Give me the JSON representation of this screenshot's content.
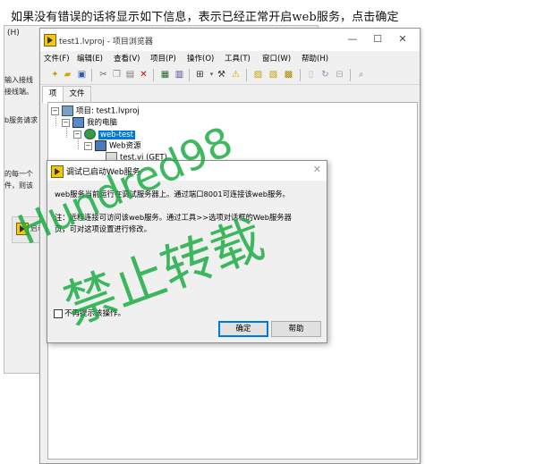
{
  "caption": "如果没有错误的话将显示如下信息，表示已经正常开启web服务，点击确定",
  "background_window": {
    "title_fragment": "(H)",
    "text_lines": [
      "输入接线",
      "接线端。",
      "b服务请求",
      "的每一个",
      "件，则该"
    ],
    "sub_window_label": "启动"
  },
  "project_window": {
    "title": "test1.lvproj - 项目浏览器",
    "controls": {
      "minimize": "—",
      "maximize": "☐",
      "close": "✕"
    },
    "menu": [
      "文件(F)",
      "编辑(E)",
      "查看(V)",
      "项目(P)",
      "操作(O)",
      "工具(T)",
      "窗口(W)",
      "帮助(H)"
    ],
    "tabs": [
      "项",
      "文件"
    ],
    "tree": {
      "project": "项目: test1.lvproj",
      "computer": "我的电脑",
      "service": "web-test",
      "resources": "Web资源",
      "vi": "test.vi (GET)"
    }
  },
  "dialog": {
    "title": "调试已启动Web服务",
    "message": "web服务当前运行在调试服务器上。通过端口8001可连接该web服务。",
    "note_line1": "注：远程连接可访问该web服务。通过工具>>选项对话框的Web服务器",
    "note_line2": "页，可对这项设置进行修改。",
    "checkbox_label": "不再提示该操作。",
    "ok_label": "确定",
    "help_label": "帮助",
    "close_glyph": "✕"
  },
  "watermark": {
    "line1": "Hundred98",
    "line2": "禁止转载"
  },
  "icons": [
    "labview-icon",
    "new-icon",
    "open-icon",
    "save-all-icon",
    "cut-icon",
    "copy-icon",
    "paste-icon",
    "delete-icon",
    "build-icon",
    "window-icon",
    "warning-icon"
  ]
}
